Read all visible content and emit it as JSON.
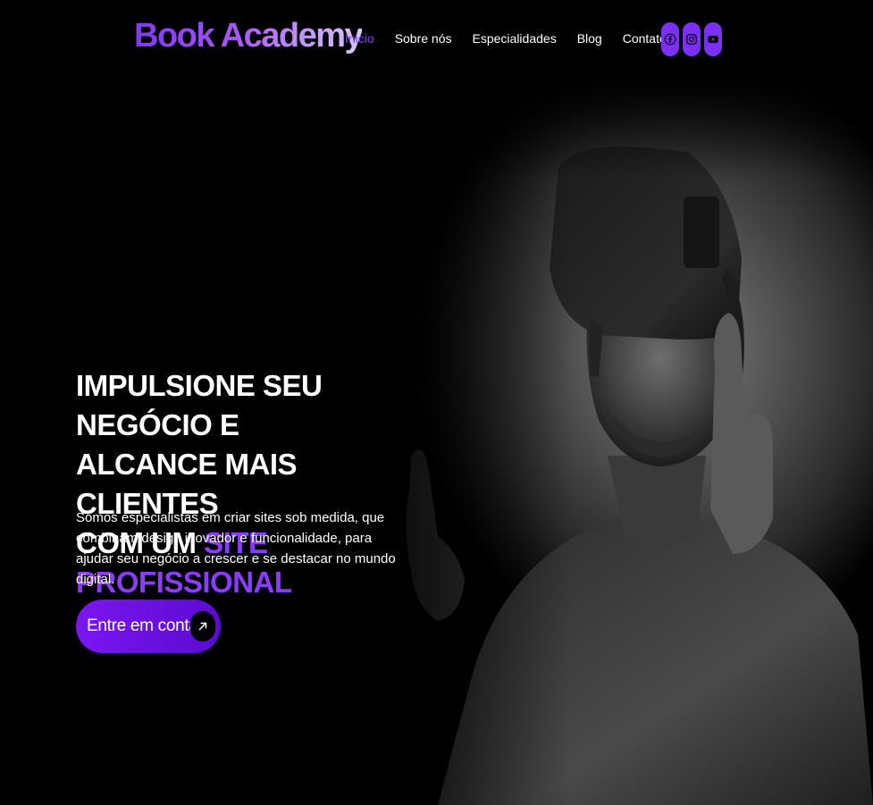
{
  "brand": {
    "logo_text": "Book Academy"
  },
  "nav": {
    "items": [
      {
        "label": "Inicio",
        "active": true
      },
      {
        "label": "Sobre nós",
        "active": false
      },
      {
        "label": "Especialidades",
        "active": false
      },
      {
        "label": "Blog",
        "active": false
      },
      {
        "label": "Contato",
        "active": false
      }
    ]
  },
  "socials": [
    {
      "icon": "facebook-icon"
    },
    {
      "icon": "instagram-icon"
    },
    {
      "icon": "youtube-icon"
    }
  ],
  "hero": {
    "headline_line1": "IMPULSIONE SEU NEGÓCIO E",
    "headline_line2": "ALCANCE MAIS CLIENTES",
    "headline_line3_prefix": "COM UM",
    "headline_highlight": "SITE PROFISSIONAL",
    "subtitle": "Somos especialistas em criar sites sob medida, que combinam design inovador e funcionalidade, para ajudar seu negócio a crescer e se destacar no mundo digital.",
    "cta_label": "Entre em contato",
    "image": "man-wearing-vr-headset-photo"
  },
  "colors": {
    "accent": "#8b3dff",
    "background": "#000000",
    "text": "#ffffff"
  }
}
